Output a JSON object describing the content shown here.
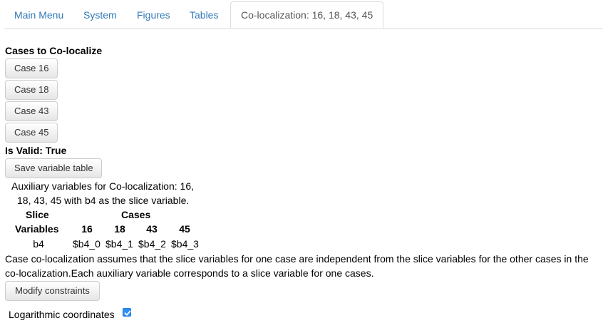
{
  "tabs": [
    {
      "label": "Main Menu"
    },
    {
      "label": "System"
    },
    {
      "label": "Figures"
    },
    {
      "label": "Tables"
    },
    {
      "label": "Co-localization: 16, 18, 43, 45",
      "active": true
    }
  ],
  "cases_section": {
    "heading": "Cases to Co-localize",
    "buttons": [
      {
        "label": "Case 16"
      },
      {
        "label": "Case 18"
      },
      {
        "label": "Case 43"
      },
      {
        "label": "Case 45"
      }
    ]
  },
  "validity": "Is Valid: True",
  "save_button": "Save variable table",
  "aux_description": {
    "line1": "Auxiliary variables for Co-localization: 16,",
    "line2": "18, 43, 45 with b4 as the slice variable."
  },
  "table": {
    "slice_header_line1": "Slice",
    "slice_header_line2": "Variables",
    "cases_header": "Cases",
    "case_columns": [
      "16",
      "18",
      "43",
      "45"
    ],
    "rows": [
      {
        "slice": "b4",
        "values": [
          "$b4_0",
          "$b4_1",
          "$b4_2",
          "$b4_3"
        ]
      }
    ]
  },
  "explanation": {
    "line1": "Case co-localization assumes that the slice variables for one case are independent from the slice variables for the other cases in the",
    "line2": "co-localization.Each auxiliary variable corresponds to a slice variable for one cases."
  },
  "modify_button": "Modify constraints",
  "log_coords": {
    "label": "Logarithmic coordinates",
    "checked": true
  },
  "colors": {
    "link": "#337ab7",
    "checkbox": "#2f8ff5"
  }
}
